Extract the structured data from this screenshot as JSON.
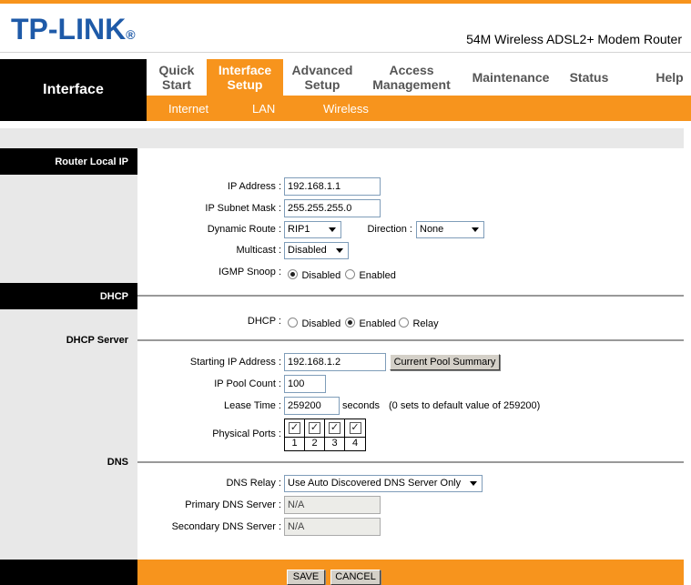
{
  "brand": {
    "logo": "TP-LINK",
    "reg": "®",
    "model": "54M Wireless ADSL2+ Modem Router"
  },
  "nav": {
    "section": "Interface",
    "items": [
      {
        "l1": "Quick",
        "l2": "Start"
      },
      {
        "l1": "Interface",
        "l2": "Setup"
      },
      {
        "l1": "Advanced",
        "l2": "Setup"
      },
      {
        "l1": "Access",
        "l2": "Management"
      },
      {
        "l1": "Maintenance",
        "l2": ""
      },
      {
        "l1": "Status",
        "l2": ""
      },
      {
        "l1": "Help",
        "l2": ""
      }
    ],
    "sub": [
      "Internet",
      "LAN",
      "Wireless"
    ]
  },
  "sections": {
    "router_local_ip": "Router Local IP",
    "dhcp": "DHCP",
    "dhcp_server": "DHCP Server",
    "dns": "DNS"
  },
  "router": {
    "ip_label": "IP Address :",
    "ip_value": "192.168.1.1",
    "mask_label": "IP Subnet Mask :",
    "mask_value": "255.255.255.0",
    "route_label": "Dynamic Route :",
    "route_value": "RIP1",
    "direction_label": "Direction :",
    "direction_value": "None",
    "multicast_label": "Multicast :",
    "multicast_value": "Disabled",
    "igmp_label": "IGMP Snoop :",
    "igmp_opt1": "Disabled",
    "igmp_opt2": "Enabled"
  },
  "dhcp": {
    "label": "DHCP :",
    "opt1": "Disabled",
    "opt2": "Enabled",
    "opt3": "Relay"
  },
  "server": {
    "start_label": "Starting IP Address :",
    "start_value": "192.168.1.2",
    "pool_button": "Current Pool Summary",
    "count_label": "IP Pool Count :",
    "count_value": "100",
    "lease_label": "Lease Time :",
    "lease_value": "259200",
    "lease_unit": "seconds",
    "lease_note": "(0 sets to default value of 259200)",
    "ports_label": "Physical Ports :",
    "ports": [
      "1",
      "2",
      "3",
      "4"
    ],
    "check": "✓"
  },
  "dns": {
    "relay_label": "DNS Relay :",
    "relay_value": "Use Auto Discovered DNS Server Only",
    "primary_label": "Primary DNS Server :",
    "primary_value": "N/A",
    "secondary_label": "Secondary DNS Server :",
    "secondary_value": "N/A"
  },
  "footer": {
    "save": "SAVE",
    "cancel": "CANCEL"
  }
}
